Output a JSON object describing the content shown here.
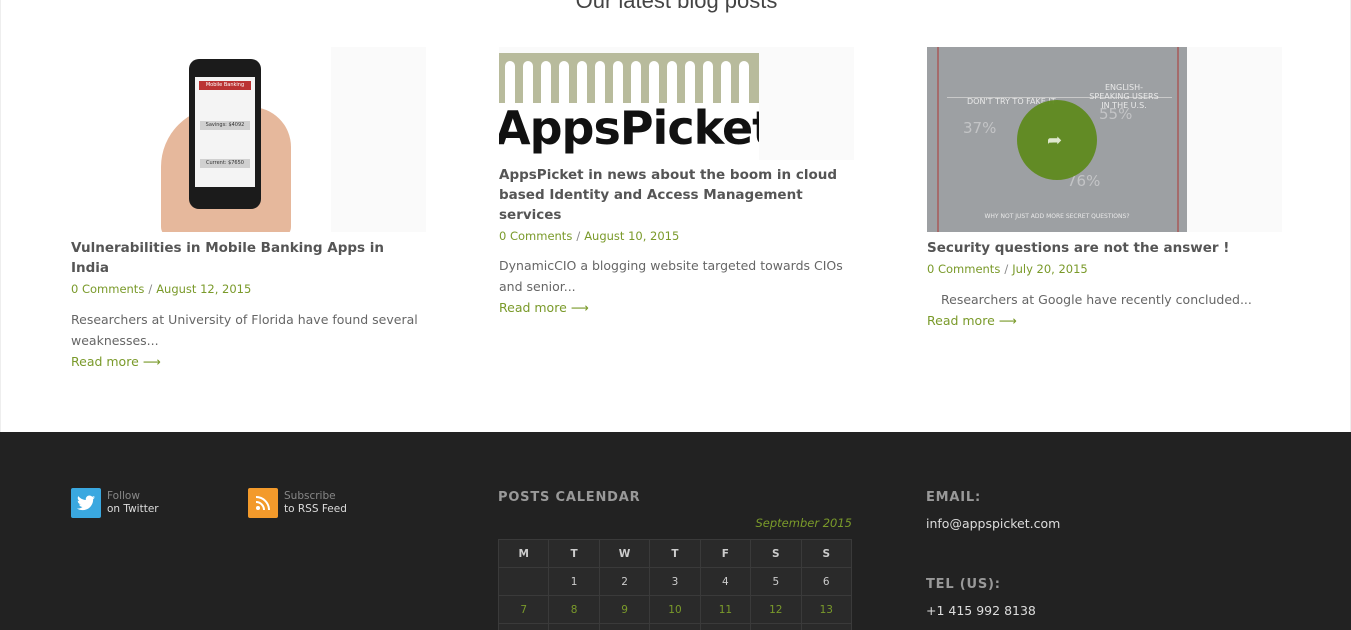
{
  "section": {
    "title": "Our latest blog posts"
  },
  "posts": [
    {
      "title": "Vulnerabilities in Mobile Banking Apps in India",
      "comments": "0 Comments",
      "separator": "/",
      "date": "August 12, 2015",
      "excerpt": "Researchers at University of Florida have found several weaknesses...",
      "read_more": "Read more ⟶",
      "image": {
        "screen_title": "Mobile Banking",
        "field1": "Savings: $4092",
        "field2": "Current: $7650"
      }
    },
    {
      "title": "AppsPicket in news about the boom in cloud based Identity and Access Management services",
      "comments": "0 Comments",
      "separator": "/",
      "date": "August 10, 2015",
      "excerpt": "DynamicCIO a blogging website targeted towards CIOs and senior...",
      "read_more": "Read more ⟶",
      "image": {
        "word": "AppsPicket"
      }
    },
    {
      "title": "Security questions are not the answer !",
      "comments": "0 Comments",
      "separator": "/",
      "date": "July 20, 2015",
      "excerpt": "Researchers at Google have recently concluded...",
      "read_more": "Read more ⟶",
      "image": {
        "t1": "DON'T TRY TO FAKE IT",
        "t2": "ENGLISH-SPEAKING USERS IN THE U.S.",
        "n1": "37%",
        "n2": "55%",
        "n3": "76%",
        "bottom": "WHY NOT JUST ADD MORE SECRET QUESTIONS?"
      }
    }
  ],
  "footer": {
    "twitter": {
      "top": "Follow",
      "bottom": "on Twitter",
      "icon": "twitter-icon",
      "color": "#3aa8e0"
    },
    "rss": {
      "top": "Subscribe",
      "bottom": "to RSS Feed",
      "icon": "rss-icon",
      "color": "#f39a2b"
    },
    "calendar": {
      "heading": "POSTS CALENDAR",
      "caption": "September 2015",
      "days": [
        "M",
        "T",
        "W",
        "T",
        "F",
        "S",
        "S"
      ],
      "rows": [
        [
          "",
          "1",
          "2",
          "3",
          "4",
          "5",
          "6"
        ],
        [
          "7",
          "8",
          "9",
          "10",
          "11",
          "12",
          "13"
        ]
      ]
    },
    "email_label": "EMAIL:",
    "email": "info@appspicket.com",
    "tel_label": "TEL (US):",
    "tel": "+1 415 992 8138"
  },
  "colors": {
    "accent": "#7a9a2a",
    "footer_bg": "#222222"
  }
}
